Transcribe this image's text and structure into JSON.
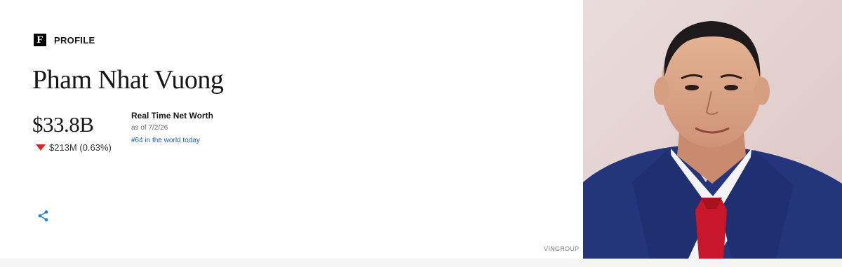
{
  "header": {
    "logo_letter": "F",
    "section_label": "PROFILE"
  },
  "person": {
    "name": "Pham Nhat Vuong",
    "net_worth": "$33.8B",
    "change": "$213M (0.63%)",
    "change_direction": "down"
  },
  "realtime": {
    "title": "Real Time Net Worth",
    "as_of": "as of 7/2/26",
    "rank": "#64 in the world today"
  },
  "photo": {
    "credit": "VINGROUP"
  },
  "icons": {
    "logo": "forbes-f-logo",
    "change": "down-triangle-icon",
    "share": "share-icon"
  },
  "colors": {
    "down": "#d12c23",
    "link": "#1f5fa8",
    "share": "#1f7fd0",
    "photo_bg": "#e8d7d6",
    "suit": "#24357c",
    "tie": "#c8172b"
  }
}
